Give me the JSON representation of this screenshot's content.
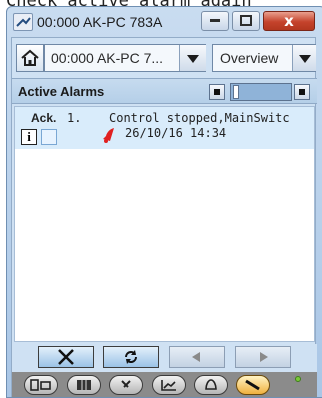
{
  "top_text": "Check active alarm again",
  "window": {
    "title": "00:000 AK-PC 783A",
    "close_label": "x"
  },
  "toolbar": {
    "device_value": "00:000 AK-PC 7...",
    "view_value": "Overview"
  },
  "header": {
    "title": "Active Alarms"
  },
  "alarm_list": {
    "ack_header": "Ack.",
    "rows": [
      {
        "index": "1.",
        "text": "Control stopped,MainSwitc",
        "time": "26/10/16 14:34",
        "info_label": "i"
      }
    ]
  },
  "colors": {
    "accent": "#cfe1f3",
    "row_highlight": "#d9ecfb",
    "alarm_red": "#e02020",
    "active_nav": "#f0b13e"
  },
  "icons": {
    "window": "monitor-icon",
    "home": "home-icon",
    "delete": "x-icon",
    "refresh": "refresh-icon",
    "prev": "arrow-left-icon",
    "next": "arrow-right-icon",
    "alarm": "bell-icon"
  }
}
